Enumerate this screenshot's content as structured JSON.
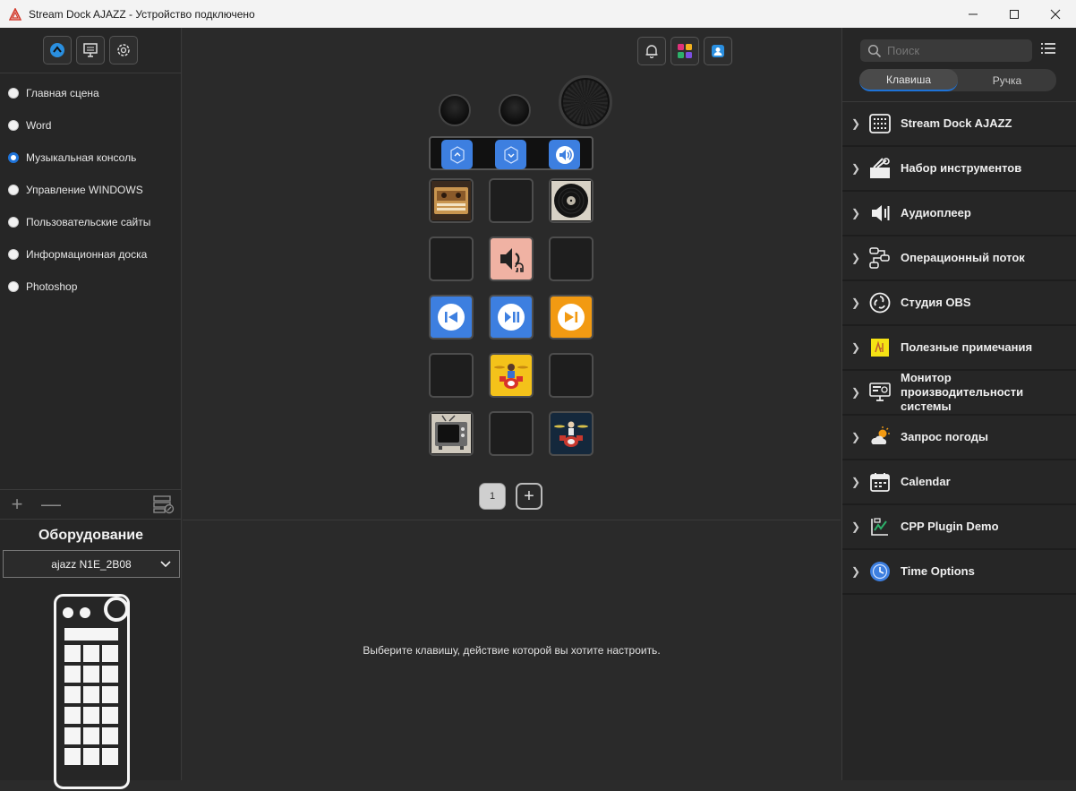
{
  "window": {
    "title": "Stream Dock AJAZZ - Устройство подключено",
    "controls": [
      "minimize-icon",
      "maximize-icon",
      "close-icon"
    ]
  },
  "left": {
    "toolbar": [
      "app-store-icon",
      "display-icon",
      "settings-icon"
    ],
    "scenes": [
      {
        "label": "Главная сцена",
        "selected": false
      },
      {
        "label": "Word",
        "selected": false
      },
      {
        "label": "Музыкальная консоль",
        "selected": true
      },
      {
        "label": "Управление WINDOWS",
        "selected": false
      },
      {
        "label": "Пользовательские сайты",
        "selected": false
      },
      {
        "label": "Информационная доска",
        "selected": false
      },
      {
        "label": "Photoshop",
        "selected": false
      }
    ],
    "tools": {
      "add": "+",
      "remove": "—"
    },
    "hardware_title": "Оборудование",
    "device_select": "ajazz N1E_2B08"
  },
  "center": {
    "top_buttons": [
      "bell-icon",
      "plugin-store-icon",
      "user-icon"
    ],
    "strip": [
      "up-icon",
      "down-icon",
      "volume-icon"
    ],
    "keys": [
      [
        "cassette-icon",
        "",
        "vinyl-icon"
      ],
      [
        "",
        "audio-output-icon",
        ""
      ],
      [
        "previous-track-icon",
        "play-pause-icon",
        "next-track-icon"
      ],
      [
        "",
        "drum-kit-yellow-icon",
        ""
      ],
      [
        "retro-tv-icon",
        "",
        "drum-kit-dark-icon"
      ]
    ],
    "page": "1",
    "add_page": "+",
    "hint": "Выберите клавишу, действие которой вы хотите настроить.",
    "colors": {
      "blue_key": "#3d7fe0",
      "orange_key": "#f29a12",
      "speaker_key": "#f0b2a3"
    }
  },
  "right": {
    "search_placeholder": "Поиск",
    "tabs": [
      {
        "label": "Клавиша",
        "active": true
      },
      {
        "label": "Ручка",
        "active": false
      }
    ],
    "categories": [
      {
        "label": "Stream Dock AJAZZ",
        "icon": "keypad-icon"
      },
      {
        "label": "Набор инструментов",
        "icon": "toolbox-icon"
      },
      {
        "label": "Аудиоплеер",
        "icon": "speaker-icon"
      },
      {
        "label": "Операционный поток",
        "icon": "flow-icon"
      },
      {
        "label": "Студия OBS",
        "icon": "obs-icon"
      },
      {
        "label": "Полезные примечания",
        "icon": "sticky-note-icon"
      },
      {
        "label": "Монитор производительности системы",
        "icon": "monitor-icon"
      },
      {
        "label": "Запрос погоды",
        "icon": "weather-icon"
      },
      {
        "label": "Calendar",
        "icon": "calendar-icon"
      },
      {
        "label": "CPP Plugin Demo",
        "icon": "chart-icon"
      },
      {
        "label": "Time Options",
        "icon": "clock-icon"
      }
    ]
  }
}
